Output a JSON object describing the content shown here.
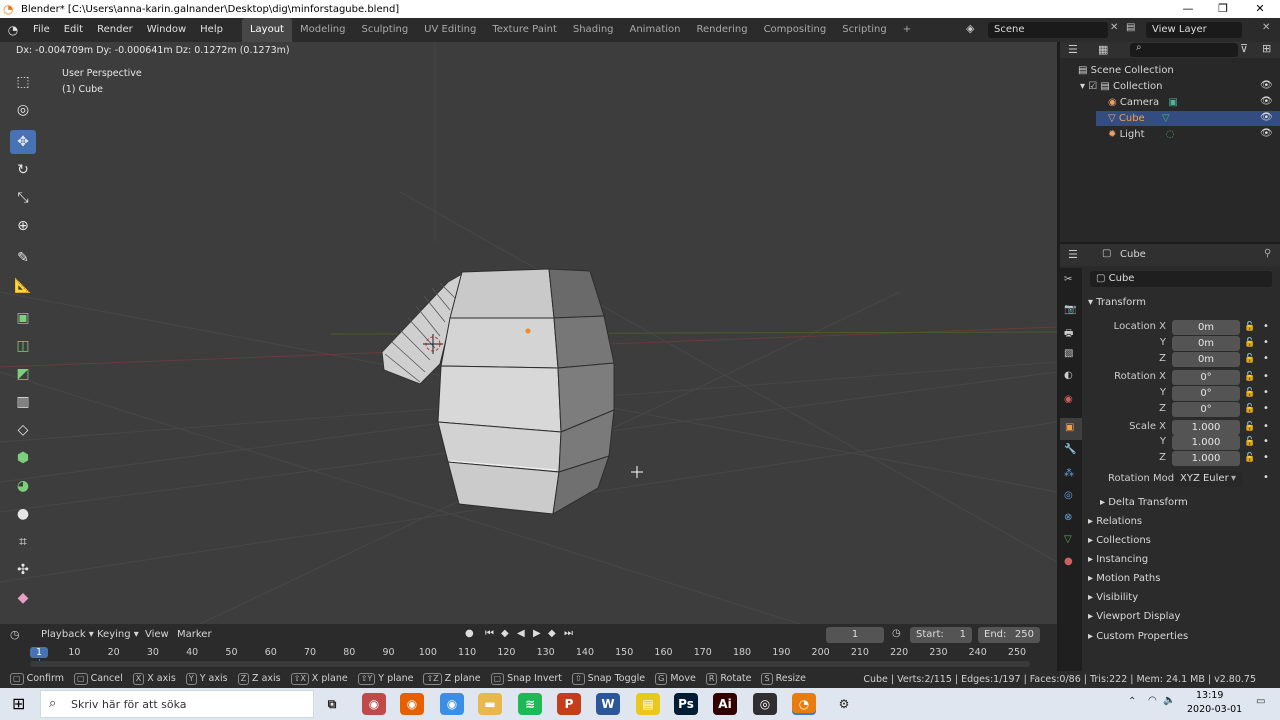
{
  "window": {
    "title": "Blender* [C:\\Users\\anna-karin.galnander\\Desktop\\dig\\minforstagube.blend]",
    "min": "—",
    "max": "❐",
    "close": "✕"
  },
  "menu": {
    "file": "File",
    "edit": "Edit",
    "render": "Render",
    "window": "Window",
    "help": "Help"
  },
  "workspaces": [
    "Layout",
    "Modeling",
    "Sculpting",
    "UV Editing",
    "Texture Paint",
    "Shading",
    "Animation",
    "Rendering",
    "Compositing",
    "Scripting",
    "+"
  ],
  "scene": {
    "name": "Scene",
    "view_layer": "View Layer"
  },
  "viewport": {
    "header_text": "Dx: -0.004709m  Dy: -0.000641m  Dz: 0.1272m (0.1273m)",
    "perspective": "User Perspective",
    "object_label": "(1) Cube"
  },
  "outliner": {
    "root": "Scene Collection",
    "collection": "Collection",
    "items": [
      {
        "name": "Camera",
        "color": "#e8a065"
      },
      {
        "name": "Cube",
        "color": "#e8a065",
        "selected": true
      },
      {
        "name": "Light",
        "color": "#e8a065"
      }
    ]
  },
  "properties": {
    "object_name": "Cube",
    "data_name": "Cube",
    "transform_title": "Transform",
    "location": {
      "label": "Location X",
      "x": "0m",
      "y": "0m",
      "z": "0m"
    },
    "rotation": {
      "label": "Rotation X",
      "x": "0°",
      "y": "0°",
      "z": "0°"
    },
    "scale": {
      "label": "Scale X",
      "x": "1.000",
      "y": "1.000",
      "z": "1.000"
    },
    "axis_y": "Y",
    "axis_z": "Z",
    "rotation_mode_label": "Rotation Mode",
    "rotation_mode": "XYZ Euler",
    "delta": "Delta Transform",
    "sections": [
      "Relations",
      "Collections",
      "Instancing",
      "Motion Paths",
      "Visibility",
      "Viewport Display",
      "Custom Properties"
    ]
  },
  "timeline": {
    "menus": [
      "Playback",
      "Keying",
      "View",
      "Marker"
    ],
    "current_frame": "1",
    "start_label": "Start:",
    "start": "1",
    "end_label": "End:",
    "end": "250",
    "ticks": [
      "1",
      "10",
      "20",
      "30",
      "40",
      "50",
      "60",
      "70",
      "80",
      "90",
      "100",
      "110",
      "120",
      "130",
      "140",
      "150",
      "160",
      "170",
      "180",
      "190",
      "200",
      "210",
      "220",
      "230",
      "240",
      "250"
    ]
  },
  "statusbar": {
    "hints": [
      {
        "key": "",
        "label": "Confirm"
      },
      {
        "key": "",
        "label": "Cancel"
      },
      {
        "key": "X",
        "label": "X axis"
      },
      {
        "key": "Y",
        "label": "Y axis"
      },
      {
        "key": "Z",
        "label": "Z axis"
      },
      {
        "key": "⇧X",
        "label": "X plane"
      },
      {
        "key": "⇧Y",
        "label": "Y plane"
      },
      {
        "key": "⇧Z",
        "label": "Z plane"
      },
      {
        "key": "",
        "label": "Snap Invert"
      },
      {
        "key": "⇧",
        "label": "Snap Toggle"
      },
      {
        "key": "G",
        "label": "Move"
      },
      {
        "key": "R",
        "label": "Rotate"
      },
      {
        "key": "S",
        "label": "Resize"
      }
    ],
    "stats": "Cube | Verts:2/115 | Edges:1/197 | Faces:0/86 | Tris:222 | Mem: 24.1 MB | v2.80.75"
  },
  "taskbar": {
    "search_placeholder": "Skriv här för att söka",
    "time": "13:19",
    "date": "2020-03-01",
    "apps": [
      {
        "name": "task-view",
        "label": "⧉",
        "color": "#dfe6ef"
      },
      {
        "name": "chrome-canary",
        "label": "◉",
        "color": "#c04a4a"
      },
      {
        "name": "firefox",
        "label": "◉",
        "color": "#e66000"
      },
      {
        "name": "chrome",
        "label": "◉",
        "color": "#3a8ee6"
      },
      {
        "name": "explorer",
        "label": "▬",
        "color": "#e8b84a"
      },
      {
        "name": "spotify",
        "label": "≋",
        "color": "#1db954"
      },
      {
        "name": "powerpoint",
        "label": "P",
        "color": "#c43e1c"
      },
      {
        "name": "word",
        "label": "W",
        "color": "#2b579a"
      },
      {
        "name": "sticky-notes",
        "label": "▤",
        "color": "#e8c81a"
      },
      {
        "name": "photoshop",
        "label": "Ps",
        "color": "#001d34"
      },
      {
        "name": "illustrator",
        "label": "Ai",
        "color": "#330000"
      },
      {
        "name": "obs",
        "label": "◎",
        "color": "#302e31"
      },
      {
        "name": "blender",
        "label": "◔",
        "color": "#e87d0d"
      },
      {
        "name": "settings",
        "label": "⚙",
        "color": "#dfe6ef"
      }
    ]
  }
}
